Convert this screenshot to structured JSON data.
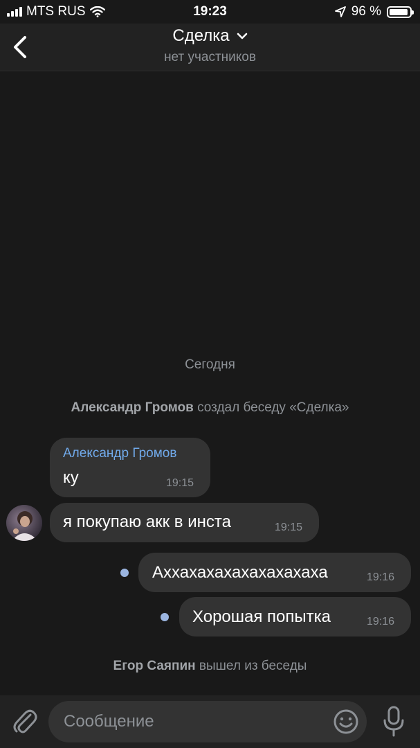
{
  "status": {
    "carrier": "MTS RUS",
    "time": "19:23",
    "battery": "96 %",
    "battery_level": 0.96
  },
  "header": {
    "title": "Сделка",
    "subtitle": "нет участников"
  },
  "chat": {
    "date_separator": "Сегодня",
    "service_created": {
      "actor": "Александр Громов",
      "text": "создал беседу «Сделка»"
    },
    "messages": [
      {
        "sender": "Александр Громов",
        "text": "ку",
        "time": "19:15",
        "direction": "in"
      },
      {
        "text": "я покупаю акк в инста",
        "time": "19:15",
        "direction": "in"
      },
      {
        "text": "Аххахахахахахахахаха",
        "time": "19:16",
        "direction": "out",
        "unread": true
      },
      {
        "text": "Хорошая попытка",
        "time": "19:16",
        "direction": "out",
        "unread": true
      }
    ],
    "service_left": {
      "actor": "Егор Саяпин",
      "text": "вышел из беседы"
    }
  },
  "composer": {
    "placeholder": "Сообщение"
  },
  "colors": {
    "background": "#191919",
    "bar": "#222222",
    "bubble": "#333333",
    "link_name": "#71aaeb",
    "unread_dot": "#9bb5e0"
  }
}
